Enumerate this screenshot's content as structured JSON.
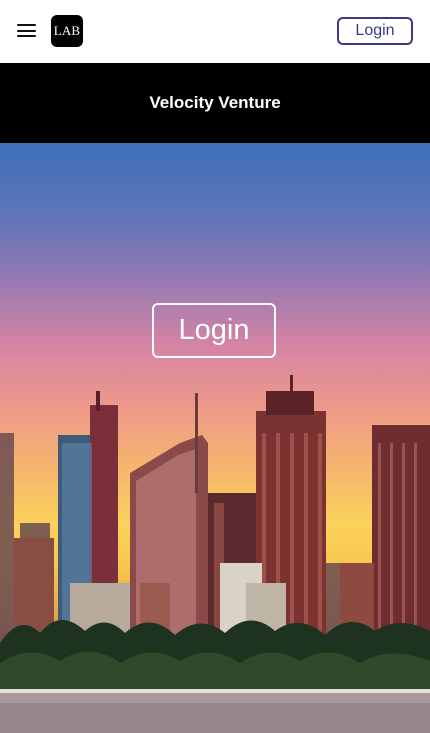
{
  "header": {
    "menu_icon": "hamburger-menu-icon",
    "logo_text": "LAB",
    "login_label": "Login",
    "accent_color": "#3b3a86"
  },
  "title_band": {
    "title": "Velocity Venture"
  },
  "hero": {
    "login_label": "Login",
    "image_subject": "city skyline at sunset"
  }
}
